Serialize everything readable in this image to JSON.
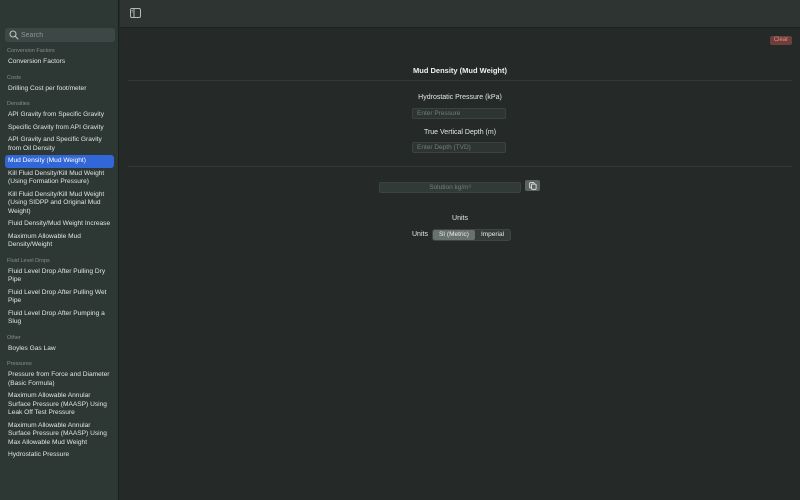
{
  "sidebar": {
    "search_placeholder": "Search",
    "sections": [
      {
        "header": "Conversion Factors",
        "items": [
          {
            "label": "Conversion Factors"
          }
        ]
      },
      {
        "header": "Costs",
        "items": [
          {
            "label": "Drilling Cost per foot/meter"
          }
        ]
      },
      {
        "header": "Densities",
        "items": [
          {
            "label": "API Gravity from Specific Gravity"
          },
          {
            "label": "Specific Gravity from API Gravity"
          },
          {
            "label": "API Gravity and Specific Gravity from Oil Density"
          },
          {
            "label": "Mud Density (Mud Weight)",
            "active": true
          },
          {
            "label": "Kill Fluid Density/Kill Mud Weight (Using Formation Pressure)"
          },
          {
            "label": "Kill Fluid Density/Kill Mud Weight (Using SIDPP and Original Mud Weight)"
          },
          {
            "label": "Fluid Density/Mud Weight Increase"
          },
          {
            "label": "Maximum Allowable Mud Density/Weight"
          }
        ]
      },
      {
        "header": "Fluid Level Drops",
        "items": [
          {
            "label": "Fluid Level Drop After Pulling Dry Pipe"
          },
          {
            "label": "Fluid Level Drop After Pulling Wet Pipe"
          },
          {
            "label": "Fluid Level Drop After Pumping a Slug"
          }
        ]
      },
      {
        "header": "Other",
        "items": [
          {
            "label": "Boyles Gas Law"
          }
        ]
      },
      {
        "header": "Pressures",
        "items": [
          {
            "label": "Pressure from Force and Diameter (Basic Formula)"
          },
          {
            "label": "Maximum Allowable Annular Surface Pressure (MAASP) Using Leak Off Test Pressure"
          },
          {
            "label": "Maximum Allowable Annular Surface Pressure (MAASP) Using Max Allowable Mud Weight"
          },
          {
            "label": "Hydrostatic Pressure"
          }
        ]
      }
    ]
  },
  "main": {
    "clear_label": "Clear",
    "title": "Mud Density (Mud Weight)",
    "pressure_label": "Hydrostatic Pressure (kPa)",
    "pressure_placeholder": "Enter Pressure",
    "depth_label": "True Vertical Depth (m)",
    "depth_placeholder": "Enter Depth (TVD)",
    "solution_placeholder": "Solution kg/m³",
    "units_title": "Units",
    "units_label": "Units",
    "unit_options": [
      "SI (Metric)",
      "Imperial"
    ],
    "selected_unit": "SI (Metric)"
  },
  "colors": {
    "accent": "#3167d6",
    "clear_button": "#6d3e3a",
    "clear_text": "#e48e84"
  },
  "icons": {
    "search": "search-icon",
    "sidebar_toggle": "sidebar-toggle-icon",
    "copy": "copy-icon"
  }
}
